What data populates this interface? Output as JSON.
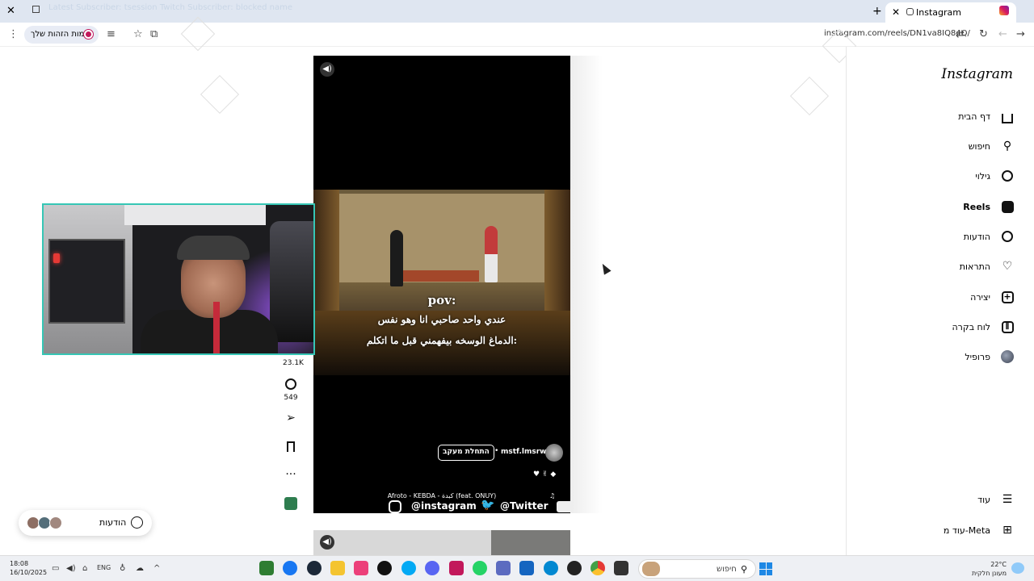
{
  "browser": {
    "tab_title": "Instagram",
    "address": "instagram.com/reels/DN1va8IQ84Q/",
    "profile_chip_label": "אימות הזהות שלך",
    "faint_header_text": "Latest Subscriber: tsession Twitch Subscriber: blocked name"
  },
  "instagram": {
    "logo": "Instagram",
    "nav": [
      {
        "label": "דף הבית",
        "icon": "home-icon"
      },
      {
        "label": "חיפוש",
        "icon": "search-icon"
      },
      {
        "label": "גילוי",
        "icon": "explore-icon"
      },
      {
        "label": "Reels",
        "icon": "reels-icon"
      },
      {
        "label": "הודעות",
        "icon": "messenger-icon"
      },
      {
        "label": "התראות",
        "icon": "heart-icon"
      },
      {
        "label": "יצירה",
        "icon": "create-icon"
      },
      {
        "label": "לוח בקרה",
        "icon": "dashboard-icon"
      },
      {
        "label": "פרופיל",
        "icon": "profile-avatar-icon"
      }
    ],
    "nav_more": "עוד",
    "nav_meta": "עוד מ-Meta"
  },
  "reel": {
    "overlay_line1": "pov:",
    "overlay_line2": "عندي واحد صاحبي انا وهو نفس",
    "overlay_line3": "الدماغ الوسخه بيفهمني قبل ما اتكلم:",
    "author": "mstf.lmsrw",
    "follow_label": "התחלת מעקב",
    "song": "Afroto - KEBDA - كبدة (feat. ONUY)",
    "likes": "23.1K",
    "comments": "549"
  },
  "messages_pill": {
    "label": "הודעות"
  },
  "stream_overlay": {
    "instagram_handle": "@instagram",
    "twitter_handle": "@Twitter"
  },
  "taskbar": {
    "time": "18:08",
    "date": "16/10/2025",
    "lang": "ENG",
    "search_placeholder": "חיפוש",
    "weather_temp": "22°C",
    "weather_desc": "מעונן חלקית"
  },
  "colors": {
    "webcam_border": "#36c6b5",
    "tabbar_bg": "#dfe6f1",
    "accent_ig": "#d81b60"
  }
}
